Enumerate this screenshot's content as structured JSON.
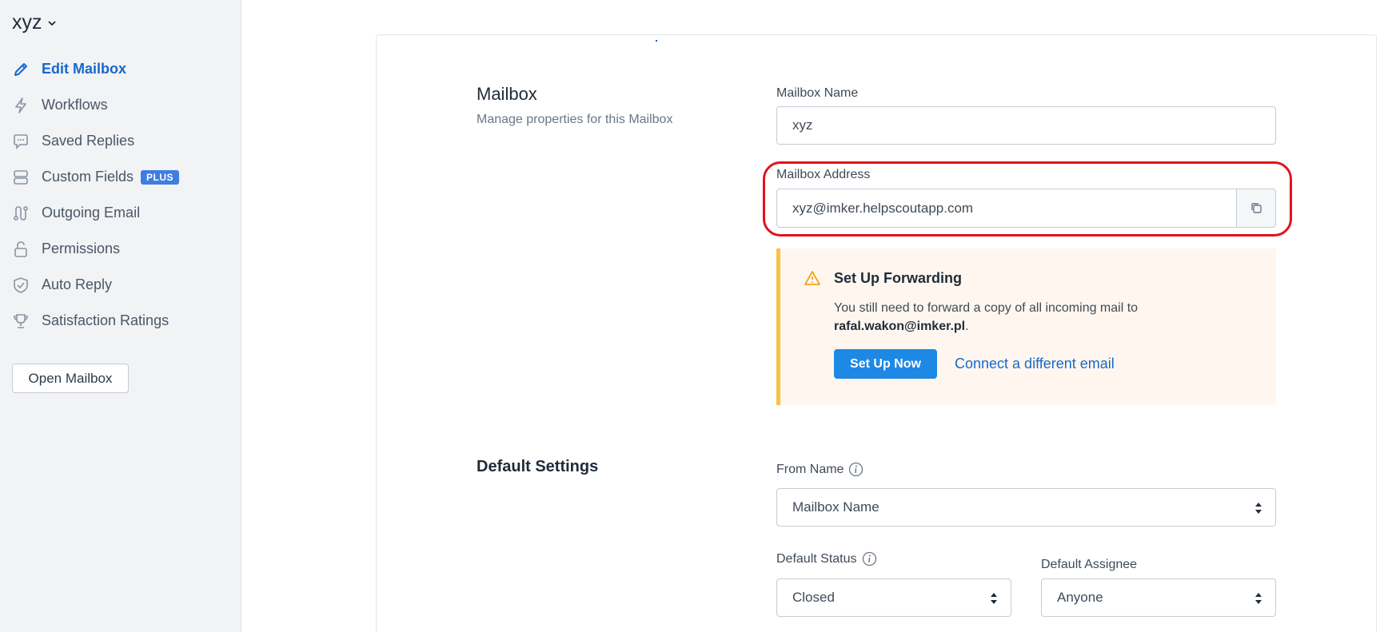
{
  "sidebar": {
    "mailbox_switcher": "xyz",
    "items": [
      {
        "label": "Edit Mailbox",
        "icon": "pencil-icon",
        "active": true
      },
      {
        "label": "Workflows",
        "icon": "lightning-icon"
      },
      {
        "label": "Saved Replies",
        "icon": "speech-bubble-icon"
      },
      {
        "label": "Custom Fields",
        "icon": "fields-icon",
        "badge": "PLUS"
      },
      {
        "label": "Outgoing Email",
        "icon": "route-icon"
      },
      {
        "label": "Permissions",
        "icon": "unlock-icon"
      },
      {
        "label": "Auto Reply",
        "icon": "shield-check-icon"
      },
      {
        "label": "Satisfaction Ratings",
        "icon": "trophy-icon"
      }
    ],
    "open_mailbox_label": "Open Mailbox"
  },
  "mailbox_section": {
    "title": "Mailbox",
    "description": "Manage properties for this Mailbox",
    "name_label": "Mailbox Name",
    "name_value": "xyz",
    "address_label": "Mailbox Address",
    "address_value": "xyz@imker.helpscoutapp.com"
  },
  "forwarding_alert": {
    "title": "Set Up Forwarding",
    "body_text": "You still need to forward a copy of all incoming mail to",
    "email": "rafal.wakon@imker.pl",
    "period": ".",
    "button_label": "Set Up Now",
    "link_label": "Connect a different email"
  },
  "default_settings": {
    "title": "Default Settings",
    "from_name_label": "From Name",
    "from_name_value": "Mailbox Name",
    "default_status_label": "Default Status",
    "default_status_value": "Closed",
    "default_assignee_label": "Default Assignee",
    "default_assignee_value": "Anyone"
  },
  "colors": {
    "accent": "#1868c9",
    "button": "#1e88e5",
    "alert_border": "#f7c244",
    "highlight": "#e0141e",
    "plus_badge": "#3f7de0"
  }
}
